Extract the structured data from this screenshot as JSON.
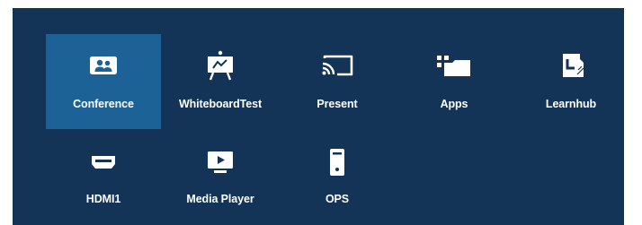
{
  "launcher": {
    "items": [
      {
        "label": "Conference",
        "icon": "conference-icon",
        "selected": true
      },
      {
        "label": "WhiteboardTest",
        "icon": "whiteboard-icon",
        "selected": false
      },
      {
        "label": "Present",
        "icon": "cast-icon",
        "selected": false
      },
      {
        "label": "Apps",
        "icon": "apps-folder-icon",
        "selected": false
      },
      {
        "label": "Learnhub",
        "icon": "learnhub-icon",
        "selected": false
      },
      {
        "label": "HDMI1",
        "icon": "hdmi-icon",
        "selected": false
      },
      {
        "label": "Media Player",
        "icon": "media-player-icon",
        "selected": false
      },
      {
        "label": "OPS",
        "icon": "ops-device-icon",
        "selected": false
      }
    ]
  },
  "colors": {
    "background": "#143457",
    "selected_tile": "#1c6297",
    "icon": "#ffffff",
    "text": "#ffffff"
  }
}
